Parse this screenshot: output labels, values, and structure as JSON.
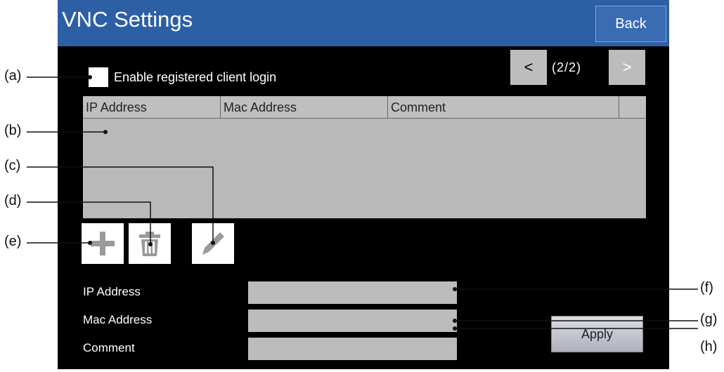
{
  "header": {
    "title": "VNC Settings",
    "back_label": "Back"
  },
  "pagination": {
    "prev_label": "<",
    "next_label": ">",
    "indicator": "(2/2)"
  },
  "login": {
    "checkbox_label": "Enable registered client login",
    "checked": false
  },
  "table": {
    "columns": [
      "IP Address",
      "Mac Address",
      "Comment"
    ],
    "rows": []
  },
  "toolbar": {
    "add": "plus-icon",
    "delete": "trash-icon",
    "edit": "pencil-icon"
  },
  "form": {
    "ip_label": "IP Address",
    "ip_value": "",
    "mac_label": "Mac Address",
    "mac_value": "",
    "comment_label": "Comment",
    "comment_value": "",
    "apply_label": "Apply"
  },
  "callouts": {
    "a": "(a)",
    "b": "(b)",
    "c": "(c)",
    "d": "(d)",
    "e": "(e)",
    "f": "(f)",
    "g": "(g)",
    "h": "(h)"
  },
  "colors": {
    "title_bar": "#2d5fa5",
    "screen_bg": "#000000",
    "panel_gray": "#b9b9b9"
  }
}
